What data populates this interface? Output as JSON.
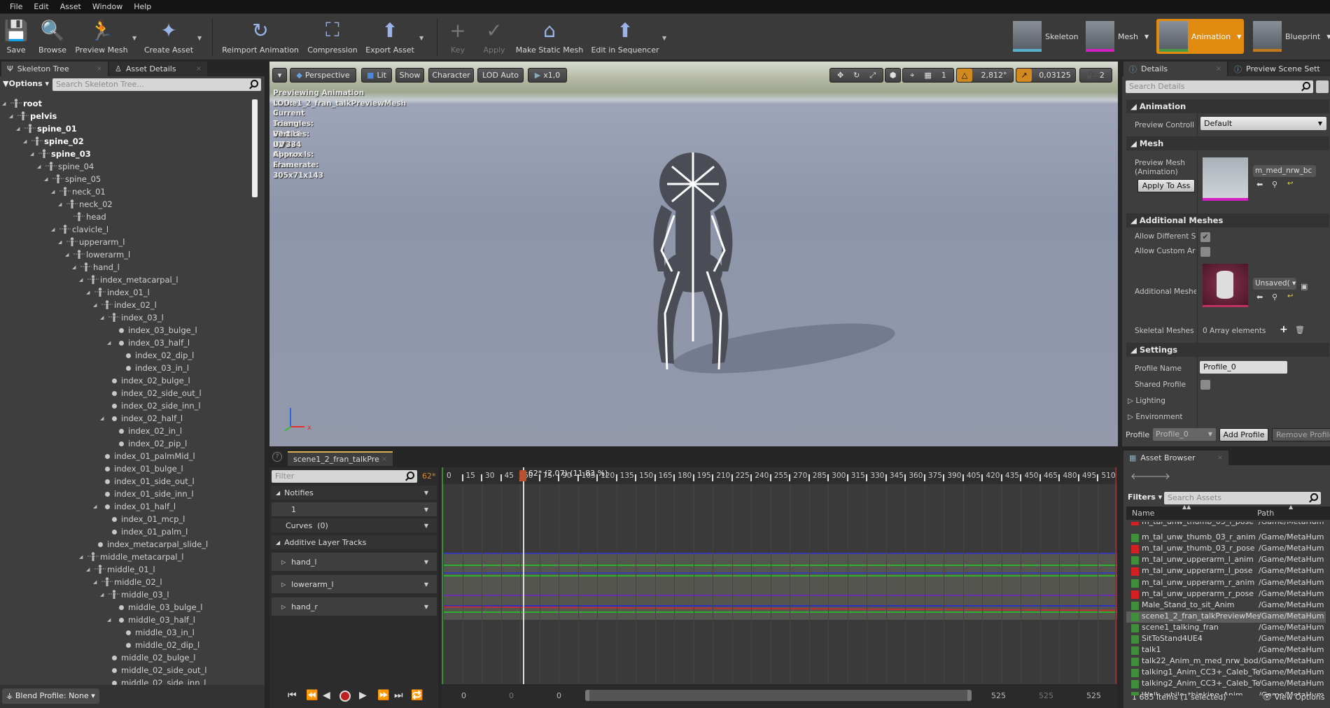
{
  "menu": [
    "File",
    "Edit",
    "Asset",
    "Window",
    "Help"
  ],
  "toolbar": {
    "buttons": [
      {
        "label": "Save",
        "icon": "save-icon"
      },
      {
        "label": "Browse",
        "icon": "browse-icon"
      },
      {
        "label": "Preview Mesh",
        "icon": "preview-mesh-icon"
      },
      {
        "label": "Create Asset",
        "icon": "create-asset-icon"
      },
      {
        "label": "Reimport Animation",
        "icon": "reimport-icon"
      },
      {
        "label": "Compression",
        "icon": "compression-icon"
      },
      {
        "label": "Export Asset",
        "icon": "export-icon"
      },
      {
        "label": "Key",
        "icon": "plus-icon",
        "disabled": true
      },
      {
        "label": "Apply",
        "icon": "check-icon",
        "disabled": true
      },
      {
        "label": "Make Static Mesh",
        "icon": "house-icon"
      },
      {
        "label": "Edit in Sequencer",
        "icon": "sequencer-icon"
      }
    ],
    "modes": [
      {
        "label": "Skeleton"
      },
      {
        "label": "Mesh"
      },
      {
        "label": "Animation",
        "active": true
      },
      {
        "label": "Blueprint"
      }
    ],
    "accent": "#e08a10"
  },
  "left": {
    "tabs": [
      "Skeleton Tree",
      "Asset Details"
    ],
    "options_label": "Options",
    "search_placeholder": "Search Skeleton Tree...",
    "blend_profile": "Blend Profile: None",
    "tree": [
      {
        "l": "root",
        "d": 0,
        "k": "bone",
        "e": true,
        "b": true
      },
      {
        "l": "pelvis",
        "d": 1,
        "k": "bone",
        "e": true,
        "b": true
      },
      {
        "l": "spine_01",
        "d": 2,
        "k": "bone",
        "e": true,
        "b": true
      },
      {
        "l": "spine_02",
        "d": 3,
        "k": "bone",
        "e": true,
        "b": true
      },
      {
        "l": "spine_03",
        "d": 4,
        "k": "bone",
        "e": true,
        "b": true
      },
      {
        "l": "spine_04",
        "d": 5,
        "k": "bone",
        "e": true
      },
      {
        "l": "spine_05",
        "d": 6,
        "k": "bone",
        "e": true
      },
      {
        "l": "neck_01",
        "d": 7,
        "k": "bone",
        "e": true
      },
      {
        "l": "neck_02",
        "d": 8,
        "k": "bone",
        "e": true
      },
      {
        "l": "head",
        "d": 9,
        "k": "bone"
      },
      {
        "l": "clavicle_l",
        "d": 7,
        "k": "bone",
        "e": true
      },
      {
        "l": "upperarm_l",
        "d": 8,
        "k": "bone",
        "e": true
      },
      {
        "l": "lowerarm_l",
        "d": 9,
        "k": "bone",
        "e": true
      },
      {
        "l": "hand_l",
        "d": 10,
        "k": "bone",
        "e": true
      },
      {
        "l": "index_metacarpal_l",
        "d": 11,
        "k": "bone",
        "e": true
      },
      {
        "l": "index_01_l",
        "d": 12,
        "k": "bone",
        "e": true
      },
      {
        "l": "index_02_l",
        "d": 13,
        "k": "bone",
        "e": true
      },
      {
        "l": "index_03_l",
        "d": 14,
        "k": "bone",
        "e": true
      },
      {
        "l": "index_03_bulge_l",
        "d": 15,
        "k": "dot"
      },
      {
        "l": "index_03_half_l",
        "d": 15,
        "k": "dot",
        "e": true
      },
      {
        "l": "index_02_dip_l",
        "d": 16,
        "k": "dot"
      },
      {
        "l": "index_03_in_l",
        "d": 16,
        "k": "dot"
      },
      {
        "l": "index_02_bulge_l",
        "d": 14,
        "k": "dot"
      },
      {
        "l": "index_02_side_out_l",
        "d": 14,
        "k": "dot"
      },
      {
        "l": "index_02_side_inn_l",
        "d": 14,
        "k": "dot"
      },
      {
        "l": "index_02_half_l",
        "d": 14,
        "k": "dot",
        "e": true
      },
      {
        "l": "index_02_in_l",
        "d": 15,
        "k": "dot"
      },
      {
        "l": "index_02_pip_l",
        "d": 15,
        "k": "dot"
      },
      {
        "l": "index_01_palmMid_l",
        "d": 13,
        "k": "dot"
      },
      {
        "l": "index_01_bulge_l",
        "d": 13,
        "k": "dot"
      },
      {
        "l": "index_01_side_out_l",
        "d": 13,
        "k": "dot"
      },
      {
        "l": "index_01_side_inn_l",
        "d": 13,
        "k": "dot"
      },
      {
        "l": "index_01_half_l",
        "d": 13,
        "k": "dot",
        "e": true
      },
      {
        "l": "index_01_mcp_l",
        "d": 14,
        "k": "dot"
      },
      {
        "l": "index_01_palm_l",
        "d": 14,
        "k": "dot"
      },
      {
        "l": "index_metacarpal_slide_l",
        "d": 12,
        "k": "dot"
      },
      {
        "l": "middle_metacarpal_l",
        "d": 11,
        "k": "bone",
        "e": true
      },
      {
        "l": "middle_01_l",
        "d": 12,
        "k": "bone",
        "e": true
      },
      {
        "l": "middle_02_l",
        "d": 13,
        "k": "bone",
        "e": true
      },
      {
        "l": "middle_03_l",
        "d": 14,
        "k": "bone",
        "e": true
      },
      {
        "l": "middle_03_bulge_l",
        "d": 15,
        "k": "dot"
      },
      {
        "l": "middle_03_half_l",
        "d": 15,
        "k": "dot",
        "e": true
      },
      {
        "l": "middle_03_in_l",
        "d": 16,
        "k": "dot"
      },
      {
        "l": "middle_02_dip_l",
        "d": 16,
        "k": "dot"
      },
      {
        "l": "middle_02_bulge_l",
        "d": 14,
        "k": "dot"
      },
      {
        "l": "middle_02_side_out_l",
        "d": 14,
        "k": "dot"
      },
      {
        "l": "middle_02_side_inn_l",
        "d": 14,
        "k": "dot"
      }
    ]
  },
  "viewport": {
    "buttons": {
      "perspective": "Perspective",
      "lit": "Lit",
      "show": "Show",
      "character": "Character",
      "lod": "LOD Auto",
      "speed": "x1,0"
    },
    "grid_snap": "1",
    "angle_snap": "2,812°",
    "scale_snap": "0,03125",
    "camera_speed": "2",
    "stats": [
      "Previewing Animation scene1_2_fran_talkPreviewMesh",
      "LOD: 0",
      "Current Screen Size: 0,726",
      "Triangles: 60 816",
      "Vertices: 32 334",
      "UV Channels: 1",
      "Approx Size: 105x71x143",
      "Framerate: 30"
    ]
  },
  "timeline": {
    "tab": "scene1_2_fran_talkPre",
    "filter_placeholder": "Filter",
    "current_frame": "62*",
    "playhead_label": "62* (2,07) (11,83 %)",
    "playhead_frame": 62,
    "total_frames": 525,
    "tick_step": 15,
    "tracks": {
      "notifies": "Notifies",
      "notify_track": "1",
      "curves": "Curves",
      "curves_count": "(0)",
      "additive": "Additive Layer Tracks",
      "bones": [
        "hand_l",
        "lowerarm_l",
        "hand_r"
      ]
    },
    "range": {
      "start": "0",
      "view_start": "0",
      "play_start": "0",
      "play_end": "525",
      "view_end": "525",
      "end": "525"
    }
  },
  "details": {
    "tabs": [
      "Details",
      "Preview Scene Sett"
    ],
    "search_placeholder": "Search Details",
    "sections": {
      "animation": "Animation",
      "mesh": "Mesh",
      "additional": "Additional Meshes",
      "settings": "Settings"
    },
    "preview_controller_label": "Preview Controll",
    "preview_controller_value": "Default",
    "preview_mesh_label": "Preview Mesh (Animation)",
    "apply_button": "Apply To Ass",
    "preview_mesh_value": "m_med_nrw_bc",
    "allow_different": "Allow Different S",
    "allow_different_checked": true,
    "allow_custom": "Allow Custom Ar",
    "allow_custom_checked": false,
    "additional_meshes_label": "Additional Meshe",
    "additional_meshes_value": "Unsaved(",
    "skeletal_meshes_label": "Skeletal Meshes",
    "skeletal_meshes_value": "0 Array elements",
    "profile_name_label": "Profile Name",
    "profile_name_value": "Profile_0",
    "shared_profile_label": "Shared Profile",
    "shared_profile_checked": false,
    "lighting": "Lighting",
    "environment": "Environment",
    "profile_label": "Profile",
    "profile_value": "Profile_0",
    "add_profile": "Add Profile",
    "remove_profile": "Remove Profile"
  },
  "assets": {
    "tab": "Asset Browser",
    "filters": "Filters",
    "search_placeholder": "Search Assets",
    "col_name": "Name",
    "col_path": "Path",
    "rows": [
      {
        "name": "m_tal_unw_thumb_03_l_pose",
        "path": "/Game/MetaHum",
        "type": "pose"
      },
      {
        "name": "m_tal_unw_thumb_03_r_anim",
        "path": "/Game/MetaHum",
        "type": "anim"
      },
      {
        "name": "m_tal_unw_thumb_03_r_pose",
        "path": "/Game/MetaHum",
        "type": "pose"
      },
      {
        "name": "m_tal_unw_upperarm_l_anim",
        "path": "/Game/MetaHum",
        "type": "anim"
      },
      {
        "name": "m_tal_unw_upperarm_l_pose",
        "path": "/Game/MetaHum",
        "type": "pose"
      },
      {
        "name": "m_tal_unw_upperarm_r_anim",
        "path": "/Game/MetaHum",
        "type": "anim"
      },
      {
        "name": "m_tal_unw_upperarm_r_pose",
        "path": "/Game/MetaHum",
        "type": "pose"
      },
      {
        "name": "Male_Stand_to_sit_Anim",
        "path": "/Game/MetaHum",
        "type": "anim"
      },
      {
        "name": "scene1_2_fran_talkPreviewMes",
        "path": "/Game/MetaHum",
        "type": "anim",
        "selected": true
      },
      {
        "name": "scene1_talking_fran",
        "path": "/Game/MetaHum",
        "type": "anim"
      },
      {
        "name": "SitToStand4UE4",
        "path": "/Game/MetaHum",
        "type": "anim"
      },
      {
        "name": "talk1",
        "path": "/Game/MetaHum",
        "type": "anim"
      },
      {
        "name": "talk22_Anim_m_med_nrw_bod",
        "path": "/Game/MetaHum",
        "type": "anim"
      },
      {
        "name": "talking1_Anim_CC3+_Caleb_Te",
        "path": "/Game/MetaHum",
        "type": "anim"
      },
      {
        "name": "talking2_Anim_CC3+_Caleb_Te",
        "path": "/Game/MetaHum",
        "type": "anim"
      },
      {
        "name": "Walk_while_thinking_Anim",
        "path": "/Game/MetaHum",
        "type": "anim"
      }
    ],
    "status": "1 685 items (1 selected)",
    "view_options": "View Options",
    "anim_color": "#3f8f3a",
    "pose_color": "#d42020"
  }
}
